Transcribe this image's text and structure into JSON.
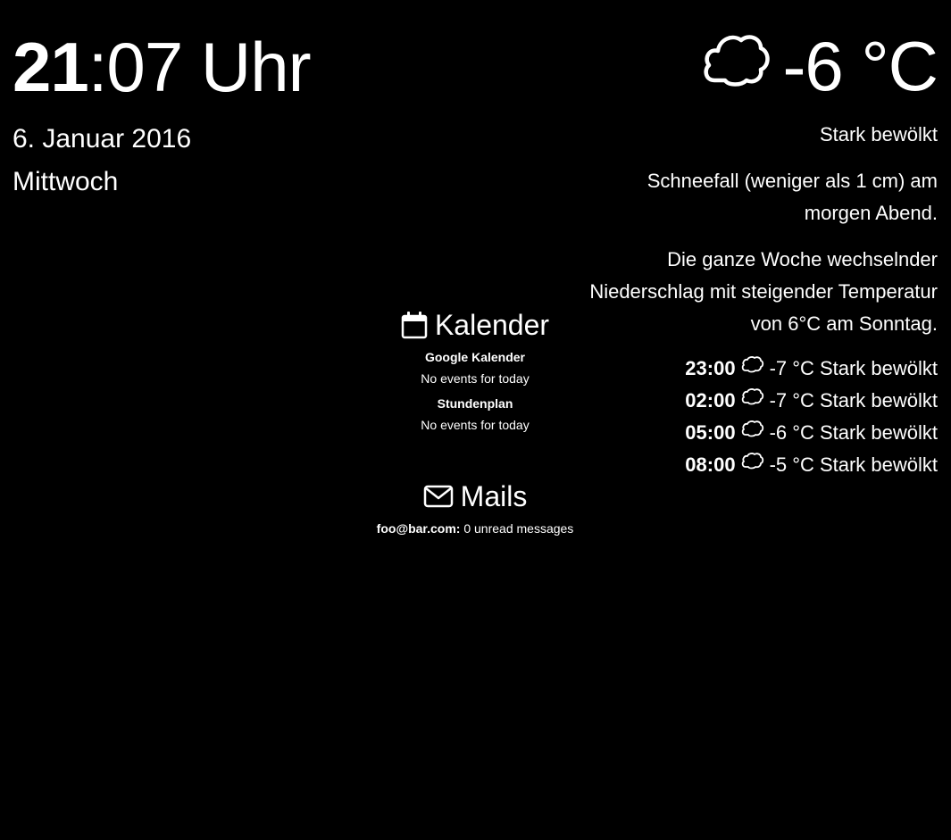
{
  "clock": {
    "hours": "21",
    "rest": ":07 Uhr",
    "date": "6. Januar 2016",
    "weekday": "Mittwoch"
  },
  "weather": {
    "current": {
      "icon": "cloud-icon",
      "temperature": "-6 °C"
    },
    "summary": "Stark bewölkt",
    "today": "Schneefall (weniger als 1 cm) am morgen Abend.",
    "week": "Die ganze Woche wechselnder Niederschlag mit steigender Temperatur von 6°C am Sonntag.",
    "forecast": [
      {
        "time": "23:00",
        "icon": "cloud-icon",
        "temp": "-7 °C",
        "text": "Stark bewölkt"
      },
      {
        "time": "02:00",
        "icon": "cloud-icon",
        "temp": "-7 °C",
        "text": "Stark bewölkt"
      },
      {
        "time": "05:00",
        "icon": "cloud-icon",
        "temp": "-6 °C",
        "text": "Stark bewölkt"
      },
      {
        "time": "08:00",
        "icon": "cloud-icon",
        "temp": "-5 °C",
        "text": "Stark bewölkt"
      }
    ]
  },
  "calendar": {
    "icon": "calendar-icon",
    "title": "Kalender",
    "calendars": [
      {
        "name": "Google Kalender",
        "status": "No events for today"
      },
      {
        "name": "Stundenplan",
        "status": "No events for today"
      }
    ]
  },
  "mails": {
    "icon": "envelope-icon",
    "title": "Mails",
    "accounts": [
      {
        "account": "foo@bar.com:",
        "status": " 0 unread messages"
      }
    ]
  },
  "colors": {
    "background": "#000000",
    "text": "#ffffff"
  }
}
